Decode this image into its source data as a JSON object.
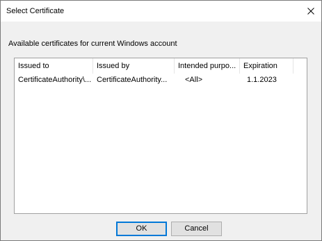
{
  "window": {
    "title": "Select Certificate",
    "close_icon": "close-icon"
  },
  "caption": "Available certificates for current Windows account",
  "list": {
    "columns": [
      "Issued to",
      "Issued by",
      "Intended purpo...",
      "Expiration"
    ],
    "rows": [
      [
        "CertificateAuthority\\...",
        "CertificateAuthority...",
        "<All>",
        "1.1.2023"
      ]
    ]
  },
  "buttons": {
    "ok_label": "OK",
    "cancel_label": "Cancel"
  },
  "colors": {
    "default_button_border": "#0078d7",
    "window_background": "#f0f0f0"
  }
}
